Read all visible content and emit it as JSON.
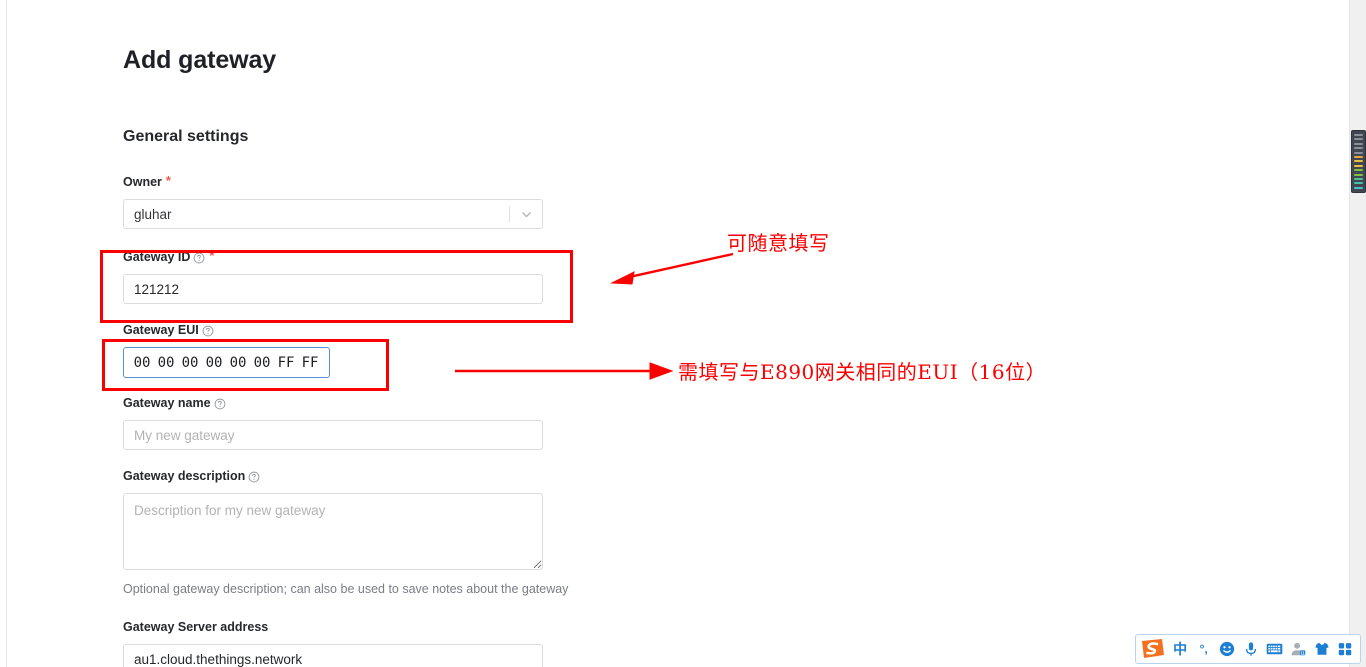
{
  "page": {
    "title": "Add gateway",
    "section_title": "General settings"
  },
  "form": {
    "owner": {
      "label": "Owner",
      "required_marker": "*",
      "value": "gluhar",
      "chevron_icon": "chevron-down-icon"
    },
    "gateway_id": {
      "label": "Gateway ID",
      "required_marker": "*",
      "help_icon": "help-circle-icon",
      "value": "121212"
    },
    "gateway_eui": {
      "label": "Gateway EUI",
      "help_icon": "help-circle-icon",
      "bytes": [
        "00",
        "00",
        "00",
        "00",
        "00",
        "00",
        "FF",
        "FF"
      ]
    },
    "gateway_name": {
      "label": "Gateway name",
      "help_icon": "help-circle-icon",
      "value": "",
      "placeholder": "My new gateway"
    },
    "gateway_description": {
      "label": "Gateway description",
      "help_icon": "help-circle-icon",
      "value": "",
      "placeholder": "Description for my new gateway",
      "hint": "Optional gateway description; can also be used to save notes about the gateway"
    },
    "gateway_server_address": {
      "label": "Gateway Server address",
      "value": "au1.cloud.thethings.network"
    }
  },
  "annotations": {
    "color": "#fc0000",
    "note_1": "可随意填写",
    "note_2": "需填写与E890网关相同的EUI（16位）"
  },
  "ime": {
    "logo": "sogou-logo-icon",
    "items": [
      {
        "name": "chinese-mode-toggle",
        "glyph": "中"
      },
      {
        "name": "punctuation-mode-toggle",
        "glyph": "°,"
      },
      {
        "name": "emoji-icon",
        "glyph": "☻"
      },
      {
        "name": "voice-input-icon",
        "glyph": "mic"
      },
      {
        "name": "soft-keyboard-icon",
        "glyph": "keyboard"
      },
      {
        "name": "user-account-icon",
        "glyph": "user"
      },
      {
        "name": "skin-icon",
        "glyph": "shirt"
      },
      {
        "name": "toolbox-icon",
        "glyph": "squares"
      }
    ]
  },
  "scrollbar": {
    "bar_colors": [
      "#8a9099",
      "#8a9099",
      "#8a9099",
      "#8a9099",
      "#8a9099",
      "#e8a33d",
      "#e8c23d",
      "#e8c23d",
      "#7fc242",
      "#7fc242",
      "#4fc28a",
      "#3fc2b0",
      "#3fc2c8"
    ]
  }
}
